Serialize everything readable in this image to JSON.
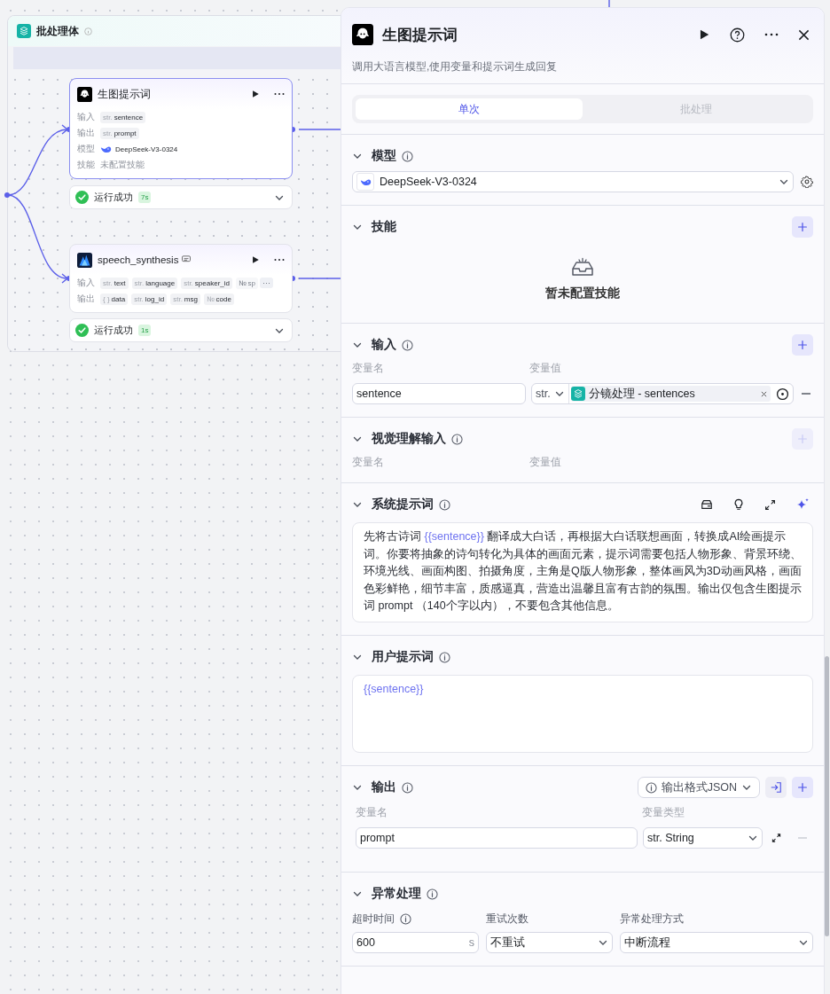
{
  "canvas": {
    "group": {
      "title": "批处理体"
    },
    "nodes": [
      {
        "kind": "llm",
        "title": "生图提示词",
        "rows": [
          {
            "label": "输入",
            "kind": "tags",
            "tags": [
              {
                "type": "str.",
                "name": "sentence",
                "faded": false
              }
            ]
          },
          {
            "label": "输出",
            "kind": "tags",
            "tags": [
              {
                "type": "str.",
                "name": "prompt",
                "faded": false
              }
            ]
          },
          {
            "label": "模型",
            "kind": "model",
            "value": "DeepSeek-V3-0324"
          },
          {
            "label": "技能",
            "kind": "muted",
            "value": "未配置技能"
          }
        ],
        "status": {
          "text": "运行成功",
          "time": "7s"
        }
      },
      {
        "kind": "plugin",
        "title": "speech_synthesis",
        "rows": [
          {
            "label": "输入",
            "kind": "tags",
            "tags": [
              {
                "type": "str.",
                "name": "text",
                "faded": false
              },
              {
                "type": "str.",
                "name": "language",
                "faded": false
              },
              {
                "type": "str.",
                "name": "speaker_id",
                "faded": false
              },
              {
                "type": "№",
                "name": "sp",
                "faded": true
              }
            ],
            "more": "···"
          },
          {
            "label": "输出",
            "kind": "tags",
            "tags": [
              {
                "type": "{ }",
                "name": "data",
                "faded": false
              },
              {
                "type": "str.",
                "name": "log_id",
                "faded": false
              },
              {
                "type": "str.",
                "name": "msg",
                "faded": false
              },
              {
                "type": "№",
                "name": "code",
                "faded": false
              }
            ]
          }
        ],
        "status": {
          "text": "运行成功",
          "time": "1s"
        }
      }
    ]
  },
  "panel": {
    "title": "生图提示词",
    "description": "调用大语言模型,使用变量和提示词生成回复",
    "tabs": [
      {
        "label": "单次",
        "selected": true
      },
      {
        "label": "批处理",
        "selected": false
      }
    ],
    "sections": [
      {
        "kind": "model",
        "title": "模型",
        "info": true,
        "model": "DeepSeek-V3-0324"
      },
      {
        "kind": "empty",
        "title": "技能",
        "info": false,
        "add_disabled": false,
        "empty_text": "暂未配置技能"
      },
      {
        "kind": "inputs",
        "title": "输入",
        "info": true,
        "add_disabled": false,
        "columns": [
          "变量名",
          "变量值"
        ],
        "rows": [
          {
            "name": "sentence",
            "type": "str.",
            "reference": "分镜处理 - sentences"
          }
        ]
      },
      {
        "kind": "inputs",
        "title": "视觉理解输入",
        "info": true,
        "add_disabled": true,
        "columns": [
          "变量名",
          "变量值"
        ]
      },
      {
        "kind": "prompt",
        "title": "系统提示词",
        "info": true,
        "tools": [
          {
            "kind": "library"
          },
          {
            "kind": "bulb"
          },
          {
            "kind": "expand"
          },
          {
            "kind": "sparkle"
          }
        ],
        "segments": [
          {
            "text": "先将古诗词 ",
            "kind": "text"
          },
          {
            "text": "{{sentence}}",
            "kind": "variable"
          },
          {
            "text": " 翻译成大白话，再根据大白话联想画面，转换成AI绘画提示词。你要将抽象的诗句转化为具体的画面元素，提示词需要包括人物形象、背景环绕、环境光线、画面构图、拍摄角度，主角是Q版人物形象，整体画风为3D动画风格，画面色彩鲜艳，细节丰富，质感逼真，营造出温馨且富有古韵的氛围。输出仅包含生图提示词 prompt （140个字以内），不要包含其他信息。",
            "kind": "text"
          }
        ]
      },
      {
        "kind": "prompt",
        "title": "用户提示词",
        "info": true,
        "segments": [
          {
            "text": "{{sentence}}",
            "kind": "variable"
          }
        ]
      },
      {
        "kind": "outputs",
        "title": "输出",
        "info": true,
        "add_disabled": false,
        "format": "输出格式JSON",
        "columns": [
          "变量名",
          "变量类型"
        ],
        "rows": [
          {
            "name": "prompt",
            "type": "str. String"
          }
        ]
      },
      {
        "kind": "exception",
        "title": "异常处理",
        "info": true,
        "fields": [
          {
            "label": "超时时间",
            "info": true,
            "kind": "number",
            "value": "600",
            "unit": "s"
          },
          {
            "label": "重试次数",
            "info": false,
            "kind": "select",
            "value": "不重试"
          },
          {
            "label": "异常处理方式",
            "info": false,
            "kind": "select",
            "value": "中断流程"
          }
        ]
      }
    ]
  }
}
